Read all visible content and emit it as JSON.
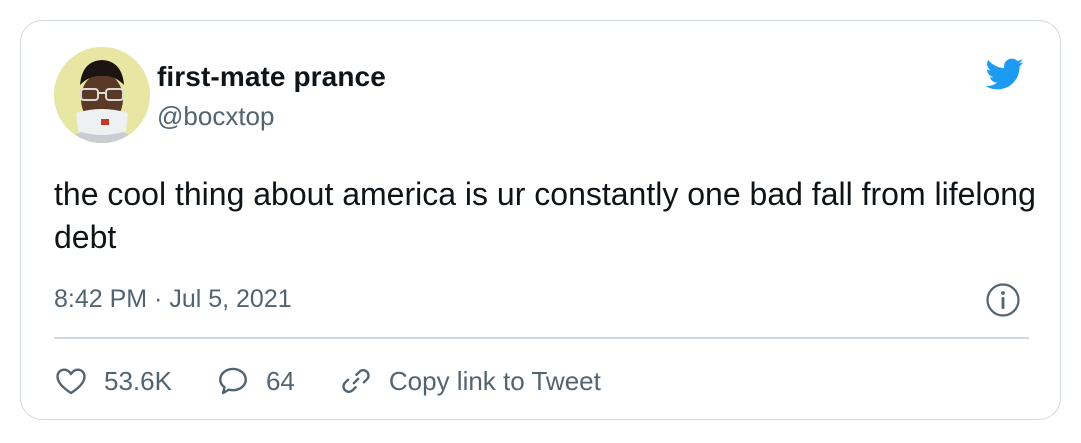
{
  "author": {
    "display_name": "first-mate prance",
    "handle": "@bocxtop"
  },
  "tweet": {
    "text": "the cool thing about america is ur constantly one bad fall from lifelong debt",
    "timestamp": "8:42 PM · Jul 5, 2021"
  },
  "actions": {
    "likes": "53.6K",
    "replies": "64",
    "copy_link": "Copy link to Tweet"
  },
  "icons": {
    "brand": "twitter-bird-icon",
    "info": "info-icon",
    "like": "heart-icon",
    "reply": "speech-bubble-icon",
    "link": "link-icon"
  },
  "colors": {
    "brand_blue": "#1d9bf0",
    "text_primary": "#0f1419",
    "text_secondary": "#536471",
    "border": "#cfd9de"
  }
}
